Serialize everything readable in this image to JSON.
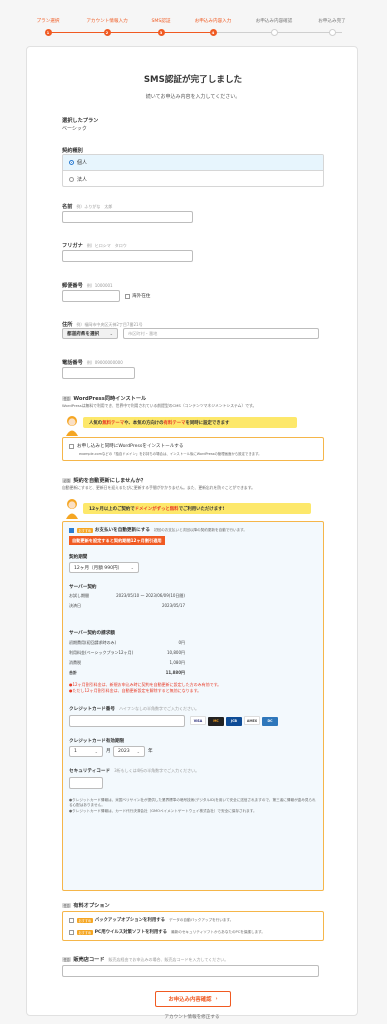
{
  "steps": [
    {
      "label": "プラン選択",
      "num": "1",
      "state": "done"
    },
    {
      "label": "アカウント情報入力",
      "num": "2",
      "state": "done"
    },
    {
      "label": "SMS認証",
      "num": "3",
      "state": "done"
    },
    {
      "label": "お申込み内容入力",
      "num": "4",
      "state": "active"
    },
    {
      "label": "お申込み内容確認",
      "num": "5",
      "state": "todo"
    },
    {
      "label": "お申込み完了",
      "num": "6",
      "state": "todo"
    }
  ],
  "header": {
    "title": "SMS認証が完了しました",
    "subtitle": "続いてお申込み内容を入力してください。"
  },
  "plan": {
    "label": "選択したプラン",
    "value": "ベーシック"
  },
  "contract_type": {
    "label": "契約種別",
    "options": [
      "個人",
      "法人"
    ],
    "selected": "個人"
  },
  "name": {
    "label": "名前",
    "hint": "例）ふりがな　太郎",
    "value": ""
  },
  "furigana": {
    "label": "フリガナ",
    "hint": "例）ヒロシマ　タロウ",
    "value": ""
  },
  "postal": {
    "label": "郵便番号",
    "hint": "例）1000001",
    "value": "",
    "overseas_label": "海外在住"
  },
  "address": {
    "label": "住所",
    "hint": "例）福岡市中央区天神2丁目7番21号",
    "prefecture_placeholder": "都道府県を選択",
    "city_placeholder": "市区町村・番地"
  },
  "phone": {
    "label": "電話番号",
    "hint": "例）09000000000",
    "value": ""
  },
  "wordpress": {
    "tag": "任意",
    "title": "WordPress同時インストール",
    "desc": "WordPressは無料で利用でき、世界中で利用されている前提型のCMS（コンテンツマネジメントシステム）です。",
    "banner_pre": "人気の",
    "banner_hl1": "無料テーマ",
    "banner_mid": "や、本気の方向けの",
    "banner_hl2": "有料テーマ",
    "banner_post": "を同時に設定できます",
    "checkbox_label": "お申し込みと同時にWordPressをインストールする",
    "checkbox_note": "example.comなどの「独自ドメイン」をお持ちの場合は、インストール後にWordPressの管理画面から設定できます。"
  },
  "autorenew": {
    "tag": "必須",
    "title": "契約を自動更新にしませんか？",
    "desc": "自動更新にすると、更新日を迎えるたびに更新する手間がかかりません。また、更新忘れを防ぐことができます。",
    "banner_pre": "12ヶ月以上のご契約で",
    "banner_hl": "ドメインがずっと無料",
    "banner_post": "でご利用いただけます!",
    "checkbox_tag": "おすすめ",
    "checkbox_label": "お支払いを自動更新にする",
    "checkbox_note": "初回のお支払いと次回以降の契約更新を自動で行います。",
    "ribbon": "自動更新を設定すると契約期間12ヶ月割引適用",
    "period_label": "契約期間",
    "period_value": "12ヶ月（月額 990円）",
    "server_title": "サーバー契約",
    "rows1": [
      {
        "k": "お試し期間",
        "v": "2023/05/10 〜 2023/06/09(10日間)"
      },
      {
        "k": "決済日",
        "v": "2023/05/17"
      }
    ],
    "fee_title": "サーバー契約の請求額",
    "rows2": [
      {
        "k": "初期費用(初回請求時のみ)",
        "v": "0円"
      },
      {
        "k": "利用料金(ベーシックプラン12ヶ月)",
        "v": "10,800円"
      },
      {
        "k": "消費税",
        "v": "1,080円"
      },
      {
        "k": "合計",
        "v": "11,880円"
      }
    ],
    "red_notes": [
      "●12ヶ月割引料金は、新規お申込み時に契約を自動更新に設定した方のみ有効です。",
      "●ただし12ヶ月割引料金は、自動更新設定を解除すると無効になります。"
    ],
    "cc_label": "クレジットカード番号",
    "cc_hint": "ハイフンなしの半角数字でご入力ください。",
    "card_brands": [
      "VISA",
      "MC",
      "JCB",
      "AMEX",
      "DC"
    ],
    "expiry_label": "クレジットカード有効期限",
    "expiry_month": "1",
    "expiry_month_unit": "月",
    "expiry_year": "2023",
    "expiry_year_unit": "年",
    "cvc_label": "セキュリティコード",
    "cvc_hint": "3桁もしくは4桁の半角数字でご入力ください。",
    "foot_notes": [
      "●クレジットカード情報は、米国ベリサイン社が提供した業界標準の暗号技術(デジタルID)を用いて安全に送信されますので、第三者に情報が盗み見られる心配はありません。",
      "●クレジットカード情報は、カード代行決済会社（GMOペイメントゲートウェイ株式会社）で安全に保存されます。"
    ]
  },
  "options": {
    "tag": "任意",
    "title": "有料オプション",
    "items": [
      {
        "tag": "おすすめ",
        "label": "バックアップオプションを利用する",
        "note": "データの自動バックアップを行います。"
      },
      {
        "tag": "おすすめ",
        "label": "PC用ウイルス対策ソフトを利用する",
        "note": "最新のセキュリティソフトからあなたのPCを保護します。"
      }
    ]
  },
  "promo": {
    "tag": "任意",
    "label": "販売店コード",
    "hint": "販売店経由でお申込みの場合、販売店コードを入力してください。",
    "value": ""
  },
  "submit": {
    "label": "お申込み内容確認",
    "sub": "アカウント情報を修正する"
  },
  "colors": {
    "accent": "#f05a22",
    "blue": "#2a7cd1",
    "yellow": "#fde86b"
  }
}
